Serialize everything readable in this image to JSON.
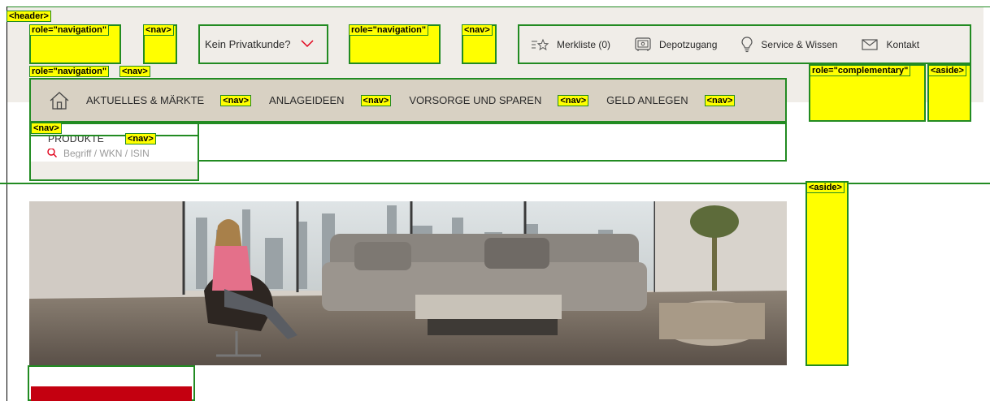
{
  "header": {
    "tag_header": "<header>",
    "tag_role_navigation": "role=\"navigation\"",
    "tag_nav": "<nav>",
    "privatkunde": {
      "label": "Kein Privatkunde?"
    },
    "service": [
      {
        "label": "Merkliste (0)",
        "icon": "star-list-icon"
      },
      {
        "label": "Depotzugang",
        "icon": "safe-icon"
      },
      {
        "label": "Service & Wissen",
        "icon": "lightbulb-icon"
      },
      {
        "label": "Kontakt",
        "icon": "envelope-icon"
      }
    ]
  },
  "aside": {
    "tag_role_complementary": "role=\"complementary\"",
    "tag_aside": "<aside>"
  },
  "main_nav": {
    "items": [
      "AKTUELLES & MÄRKTE",
      "ANLAGEIDEEN",
      "VORSORGE UND SPAREN",
      "GELD ANLEGEN"
    ]
  },
  "sub_nav": {
    "produkte_label": "PRODUKTE",
    "search_placeholder": "Begriff / WKN / ISIN"
  },
  "colors": {
    "accent": "#e10019",
    "nav_bg": "#d8d1c3",
    "header_bg": "#f0ede8",
    "annotation_border": "#228b22",
    "annotation_tag": "#ffff00"
  }
}
